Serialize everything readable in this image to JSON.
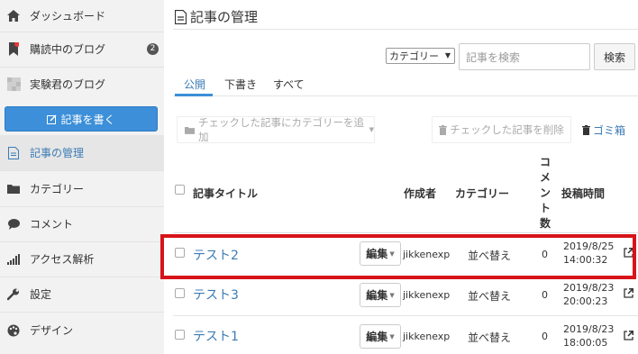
{
  "sidebar": {
    "items": [
      {
        "label": "ダッシュボード",
        "icon": "home-icon"
      },
      {
        "label": "購読中のブログ",
        "icon": "bookmark-icon",
        "badge": "2"
      },
      {
        "label": "実験君のブログ",
        "icon": "blog-thumbnail"
      },
      {
        "label": "記事の管理",
        "icon": "document-icon",
        "active": true
      },
      {
        "label": "カテゴリー",
        "icon": "folder-icon"
      },
      {
        "label": "コメント",
        "icon": "comment-icon"
      },
      {
        "label": "アクセス解析",
        "icon": "bar-chart-icon"
      },
      {
        "label": "設定",
        "icon": "wrench-icon"
      },
      {
        "label": "デザイン",
        "icon": "palette-icon"
      }
    ],
    "write_button": "記事を書く"
  },
  "main": {
    "title": "記事の管理",
    "category_select": "カテゴリー",
    "search_placeholder": "記事を検索",
    "search_button": "検索",
    "tabs": [
      "公開",
      "下書き",
      "すべて"
    ],
    "add_category_button": "チェックした記事にカテゴリーを追加",
    "delete_button": "チェックした記事を削除",
    "trash_link": "ゴミ箱",
    "columns": {
      "title": "記事タイトル",
      "author": "作成者",
      "category": "カテゴリー",
      "comments_lines": [
        "コ",
        "メ",
        "ン",
        "ト",
        "数"
      ],
      "posted": "投稿時間"
    },
    "edit_label": "編集",
    "rows": [
      {
        "title": "テスト2",
        "author": "jikkenexp",
        "category": "並べ替え",
        "comments": "0",
        "date": "2019/8/25",
        "time": "14:00:32"
      },
      {
        "title": "テスト3",
        "author": "jikkenexp",
        "category": "並べ替え",
        "comments": "0",
        "date": "2019/8/23",
        "time": "20:00:23"
      },
      {
        "title": "テスト1",
        "author": "jikkenexp",
        "category": "並べ替え",
        "comments": "0",
        "date": "2019/8/23",
        "time": "18:00:05"
      }
    ]
  },
  "colors": {
    "accent": "#3c8fd8",
    "link": "#3c7cb5",
    "highlight": "#d7141a"
  }
}
